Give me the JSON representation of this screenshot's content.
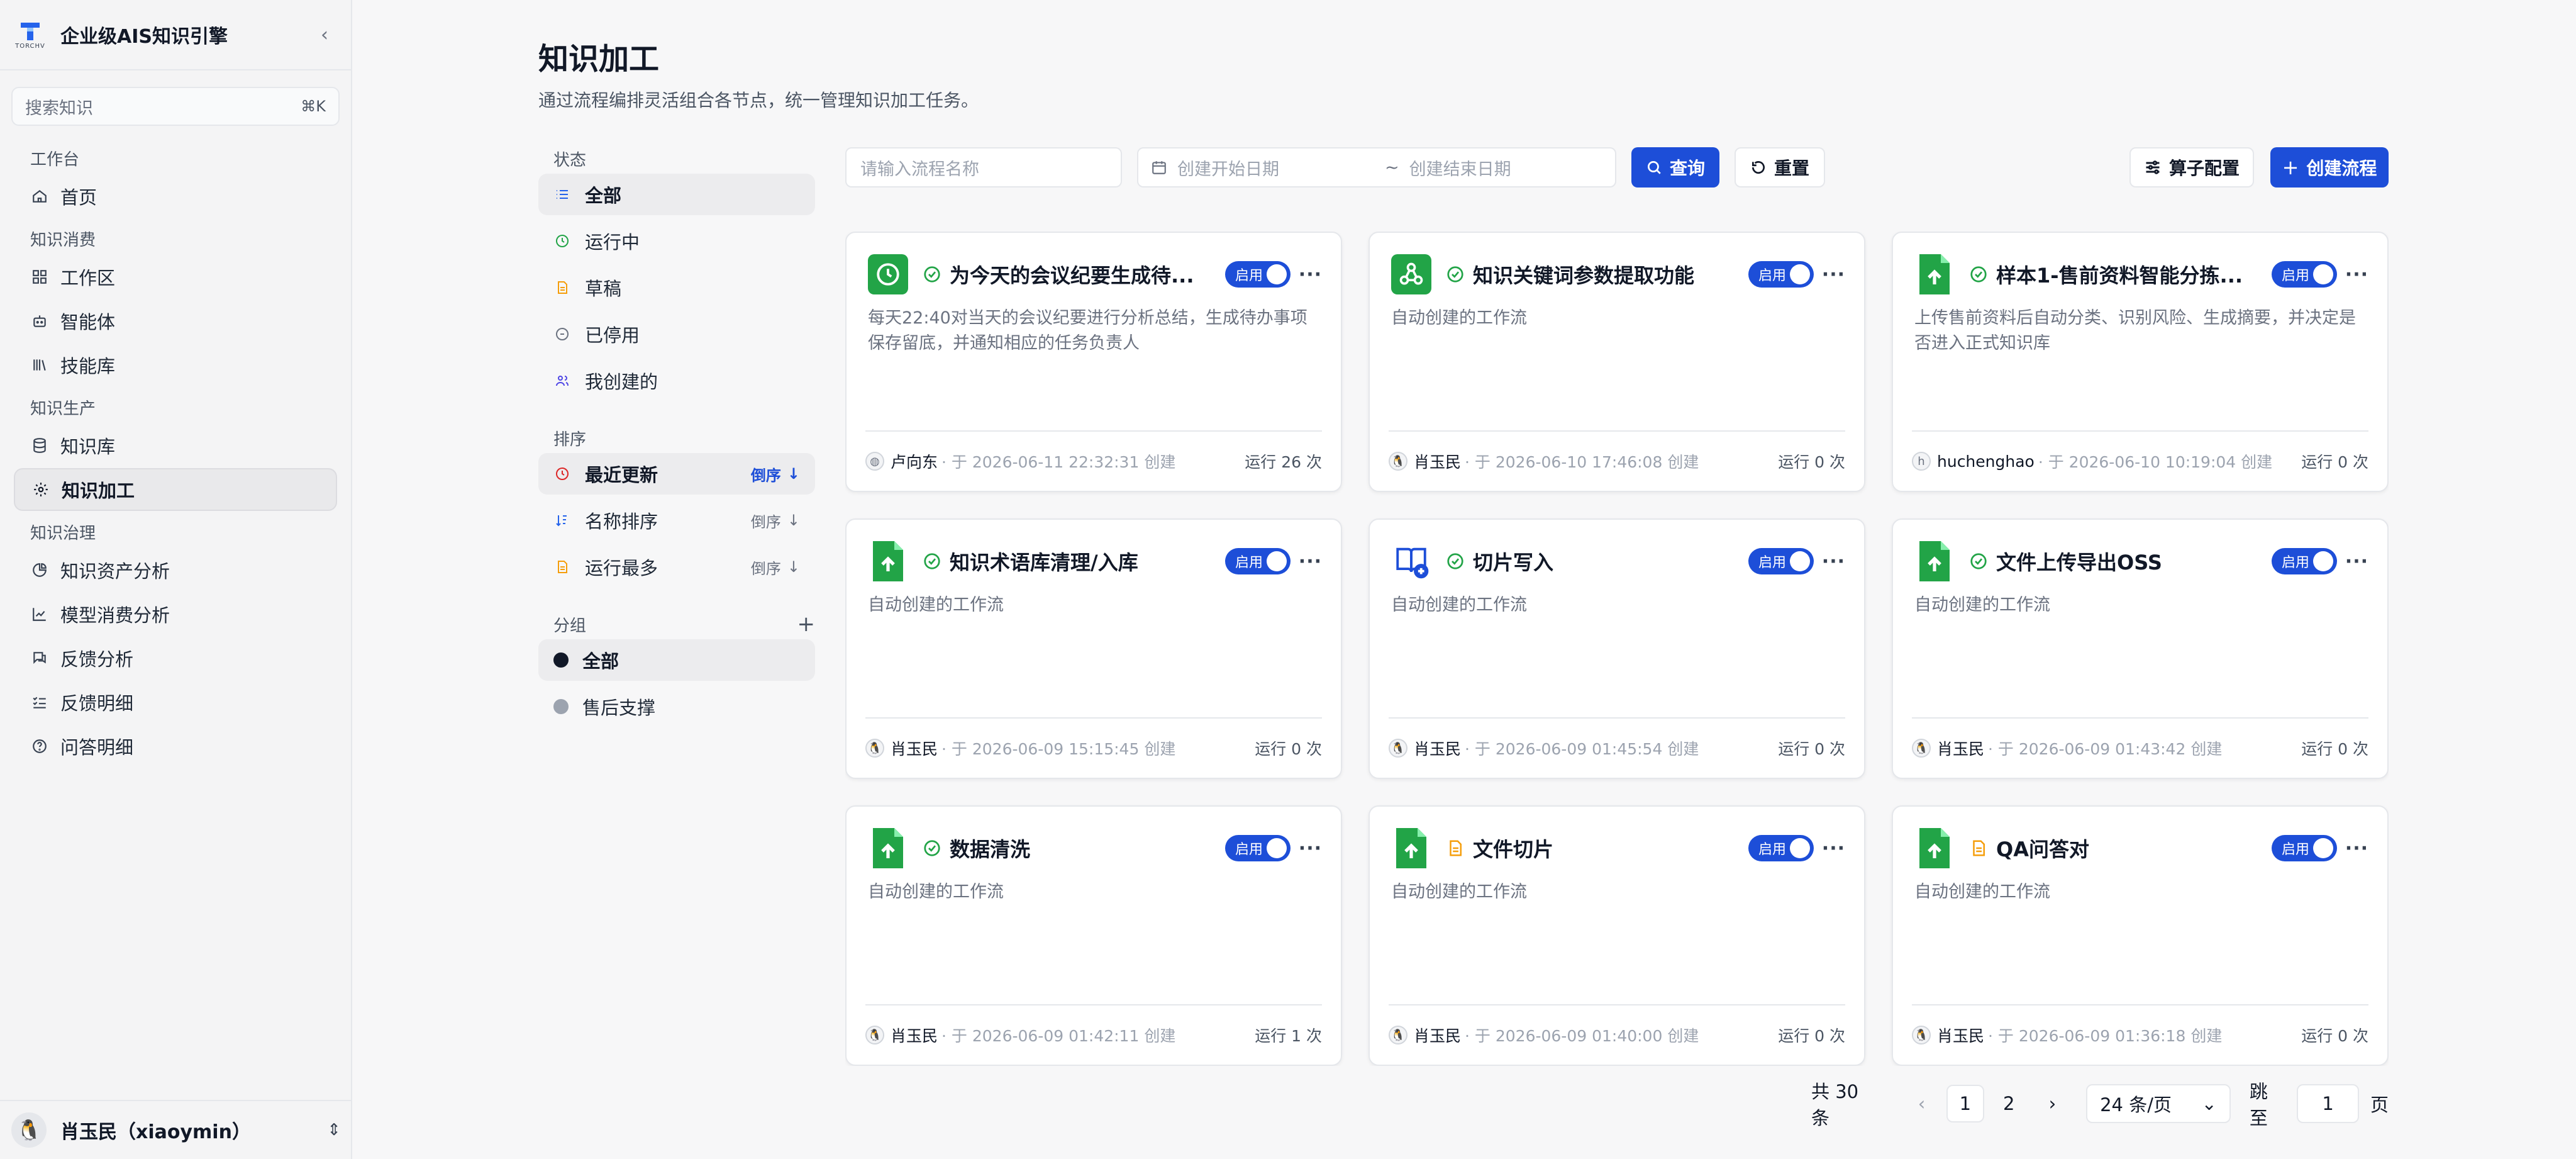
{
  "app": {
    "name": "企业级AIS知识引擎",
    "logo_text": "TORCHV"
  },
  "search": {
    "placeholder": "搜索知识",
    "shortcut": "⌘K"
  },
  "nav": {
    "group_workbench": "工作台",
    "home": "首页",
    "group_consume": "知识消费",
    "workspace": "工作区",
    "agents": "智能体",
    "skills": "技能库",
    "group_produce": "知识生产",
    "kb": "知识库",
    "processing": "知识加工",
    "group_govern": "知识治理",
    "asset_analysis": "知识资产分析",
    "model_analysis": "模型消费分析",
    "feedback_analysis": "反馈分析",
    "feedback_detail": "反馈明细",
    "qa_detail": "问答明细"
  },
  "user": {
    "name": "肖玉民（xiaoymin）"
  },
  "page": {
    "title": "知识加工",
    "subtitle": "通过流程编排灵活组合各节点，统一管理知识加工任务。"
  },
  "filter": {
    "status_label": "状态",
    "status": [
      "全部",
      "运行中",
      "草稿",
      "已停用",
      "我创建的"
    ],
    "sort_label": "排序",
    "sorts": [
      {
        "label": "最近更新",
        "order": "倒序"
      },
      {
        "label": "名称排序",
        "order": "倒序"
      },
      {
        "label": "运行最多",
        "order": "倒序"
      }
    ],
    "group_label": "分组",
    "groups": [
      "全部",
      "售后支撑"
    ]
  },
  "toolbar": {
    "name_placeholder": "请输入流程名称",
    "start_placeholder": "创建开始日期",
    "date_sep": "~",
    "end_placeholder": "创建结束日期",
    "query": "查询",
    "reset": "重置",
    "operator_config": "算子配置",
    "create": "创建流程"
  },
  "toggle_label": "启用",
  "cards": [
    {
      "name": "为今天的会议纪要生成待...",
      "desc": "每天22:40对当天的会议纪要进行分析总结，生成待办事项保存留底，并通知相应的任务负责人",
      "author": "卢向东",
      "meta": "· 于 2026-06-11 22:32:31 创建",
      "runs": "运行 26 次",
      "icon": "clock-icon",
      "status": "ok"
    },
    {
      "name": "知识关键词参数提取功能",
      "desc": "自动创建的工作流",
      "author": "肖玉民",
      "meta": "· 于 2026-06-10 17:46:08 创建",
      "runs": "运行 0 次",
      "icon": "webhook-icon",
      "status": "ok"
    },
    {
      "name": "样本1-售前资料智能分拣...",
      "desc": "上传售前资料后自动分类、识别风险、生成摘要，并决定是否进入正式知识库",
      "author": "huchenghao",
      "meta": "· 于 2026-06-10 10:19:04 创建",
      "runs": "运行 0 次",
      "icon": "upload-file-icon",
      "status": "ok"
    },
    {
      "name": "知识术语库清理/入库",
      "desc": "自动创建的工作流",
      "author": "肖玉民",
      "meta": "· 于 2026-06-09 15:15:45 创建",
      "runs": "运行 0 次",
      "icon": "upload-file-icon",
      "status": "ok"
    },
    {
      "name": "切片写入",
      "desc": "自动创建的工作流",
      "author": "肖玉民",
      "meta": "· 于 2026-06-09 01:45:54 创建",
      "runs": "运行 0 次",
      "icon": "book-plus-icon",
      "status": "ok"
    },
    {
      "name": "文件上传导出OSS",
      "desc": "自动创建的工作流",
      "author": "肖玉民",
      "meta": "· 于 2026-06-09 01:43:42 创建",
      "runs": "运行 0 次",
      "icon": "upload-file-icon",
      "status": "ok"
    },
    {
      "name": "数据清洗",
      "desc": "自动创建的工作流",
      "author": "肖玉民",
      "meta": "· 于 2026-06-09 01:42:11 创建",
      "runs": "运行 1 次",
      "icon": "upload-file-icon",
      "status": "ok"
    },
    {
      "name": "文件切片",
      "desc": "自动创建的工作流",
      "author": "肖玉民",
      "meta": "· 于 2026-06-09 01:40:00 创建",
      "runs": "运行 0 次",
      "icon": "upload-file-icon",
      "status": "draft"
    },
    {
      "name": "QA问答对",
      "desc": "自动创建的工作流",
      "author": "肖玉民",
      "meta": "· 于 2026-06-09 01:36:18 创建",
      "runs": "运行 0 次",
      "icon": "upload-file-icon",
      "status": "draft"
    }
  ],
  "pager": {
    "total": "共 30 条",
    "pages": [
      "1",
      "2"
    ],
    "size": "24 条/页",
    "jump_label": "跳至",
    "jump_value": "1",
    "page_unit": "页"
  },
  "colors": {
    "primary": "#1d4ed8",
    "green": "#22a447",
    "orange": "#f59e0b"
  }
}
